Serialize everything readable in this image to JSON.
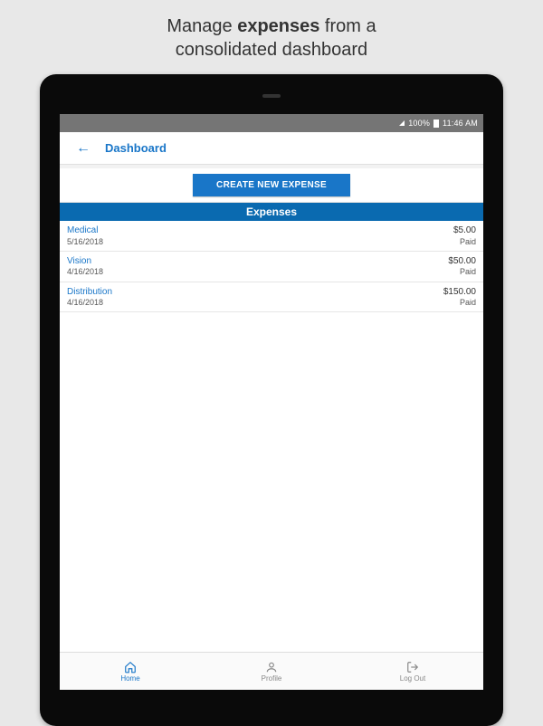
{
  "caption": {
    "pre": "Manage ",
    "bold": "expenses",
    "post": " from a\nconsolidated dashboard"
  },
  "statusbar": {
    "battery": "100%",
    "time": "11:46 AM"
  },
  "header": {
    "title": "Dashboard"
  },
  "create_button_label": "CREATE NEW EXPENSE",
  "section_title": "Expenses",
  "expenses": [
    {
      "title": "Medical",
      "date": "5/16/2018",
      "amount": "$5.00",
      "status": "Paid"
    },
    {
      "title": "Vision",
      "date": "4/16/2018",
      "amount": "$50.00",
      "status": "Paid"
    },
    {
      "title": "Distribution",
      "date": "4/16/2018",
      "amount": "$150.00",
      "status": "Paid"
    }
  ],
  "nav": {
    "home": "Home",
    "profile": "Profile",
    "logout": "Log Out"
  },
  "colors": {
    "accent": "#1976c8",
    "section": "#0a6ab0"
  }
}
